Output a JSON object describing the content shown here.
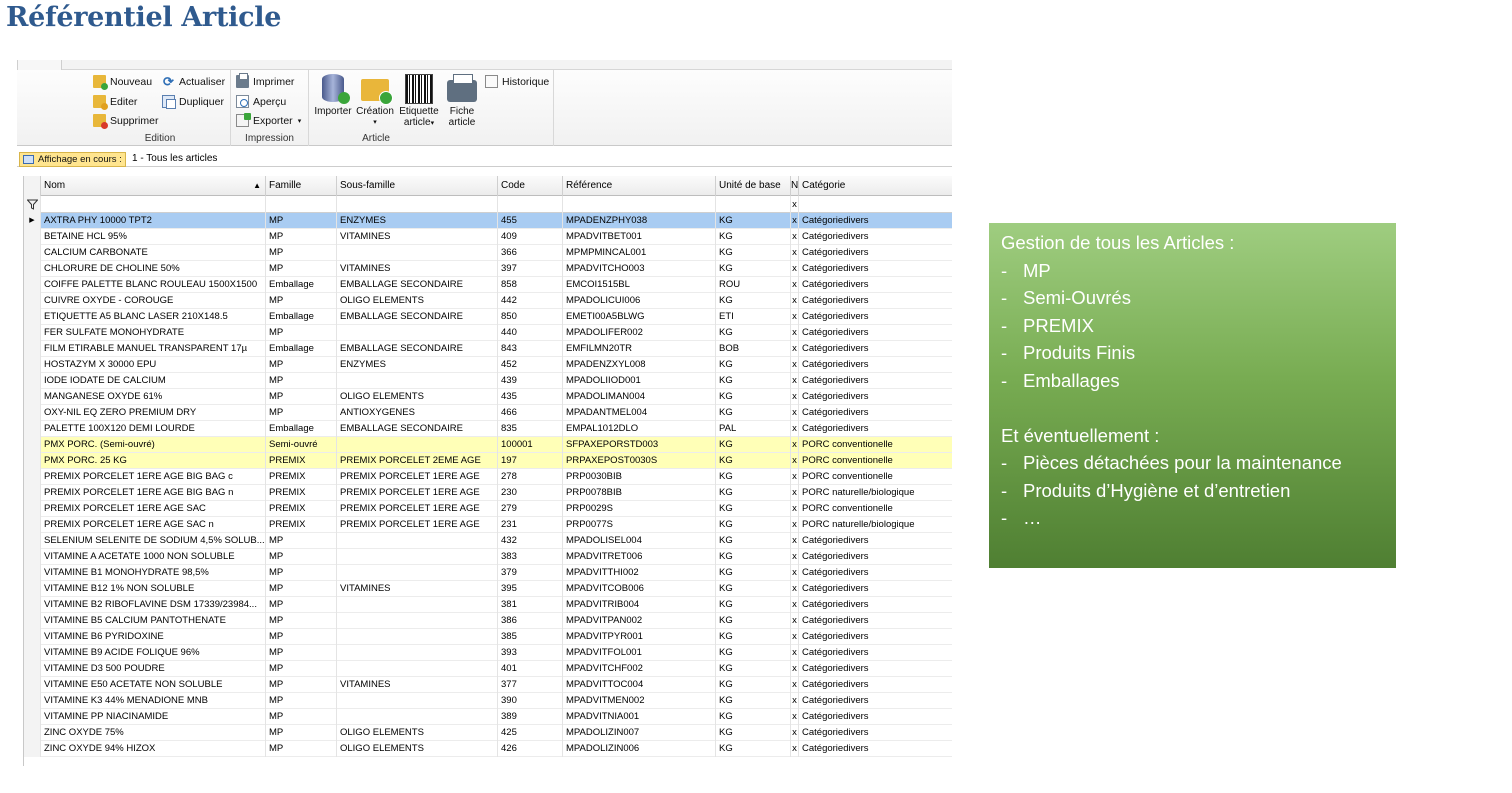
{
  "title": "Référentiel Article",
  "ribbon": {
    "edition": {
      "label": "Edition",
      "nouveau": "Nouveau",
      "actualiser": "Actualiser",
      "editer": "Editer",
      "dupliquer": "Dupliquer",
      "supprimer": "Supprimer"
    },
    "impression": {
      "label": "Impression",
      "imprimer": "Imprimer",
      "apercu": "Aperçu",
      "exporter": "Exporter"
    },
    "article": {
      "label": "Article",
      "importer": "Importer",
      "creation": "Création",
      "etiquette_1": "Etiquette",
      "etiquette_2": "article",
      "fiche_1": "Fiche",
      "fiche_2": "article",
      "historique": "Historique"
    }
  },
  "view": {
    "label": "Affichage en cours :",
    "value": "1 - Tous les articles"
  },
  "columns": {
    "nom": "Nom",
    "famille": "Famille",
    "sous_famille": "Sous-famille",
    "code": "Code",
    "reference": "Référence",
    "unite": "Unité de base",
    "n": "N",
    "categorie": "Catégorie"
  },
  "filter_row": {
    "n": "x"
  },
  "rows": [
    {
      "nom": "AXTRA PHY 10000 TPT2",
      "famille": "MP",
      "sous": "ENZYMES",
      "code": "455",
      "ref": "MPADENZPHY038",
      "unite": "KG",
      "n": "x",
      "cat": "Catégoriedivers",
      "state": "selected"
    },
    {
      "nom": "BETAINE HCL 95%",
      "famille": "MP",
      "sous": "VITAMINES",
      "code": "409",
      "ref": "MPADVITBET001",
      "unite": "KG",
      "n": "x",
      "cat": "Catégoriedivers"
    },
    {
      "nom": "CALCIUM CARBONATE",
      "famille": "MP",
      "sous": "",
      "code": "366",
      "ref": "MPMPMINCAL001",
      "unite": "KG",
      "n": "x",
      "cat": "Catégoriedivers"
    },
    {
      "nom": "CHLORURE DE CHOLINE 50%",
      "famille": "MP",
      "sous": "VITAMINES",
      "code": "397",
      "ref": "MPADVITCHO003",
      "unite": "KG",
      "n": "x",
      "cat": "Catégoriedivers"
    },
    {
      "nom": "COIFFE PALETTE BLANC ROULEAU 1500X1500",
      "famille": "Emballage",
      "sous": "EMBALLAGE SECONDAIRE",
      "code": "858",
      "ref": "EMCOI1515BL",
      "unite": "ROU",
      "n": "x",
      "cat": "Catégoriedivers"
    },
    {
      "nom": "CUIVRE OXYDE - COROUGE",
      "famille": "MP",
      "sous": "OLIGO ELEMENTS",
      "code": "442",
      "ref": "MPADOLICUI006",
      "unite": "KG",
      "n": "x",
      "cat": "Catégoriedivers"
    },
    {
      "nom": "ETIQUETTE A5 BLANC LASER 210X148.5",
      "famille": "Emballage",
      "sous": "EMBALLAGE SECONDAIRE",
      "code": "850",
      "ref": "EMETI00A5BLWG",
      "unite": "ETI",
      "n": "x",
      "cat": "Catégoriedivers"
    },
    {
      "nom": "FER SULFATE MONOHYDRATE",
      "famille": "MP",
      "sous": "",
      "code": "440",
      "ref": "MPADOLIFER002",
      "unite": "KG",
      "n": "x",
      "cat": "Catégoriedivers"
    },
    {
      "nom": "FILM ETIRABLE MANUEL TRANSPARENT 17µ",
      "famille": "Emballage",
      "sous": "EMBALLAGE SECONDAIRE",
      "code": "843",
      "ref": "EMFILMN20TR",
      "unite": "BOB",
      "n": "x",
      "cat": "Catégoriedivers"
    },
    {
      "nom": "HOSTAZYM X 30000 EPU",
      "famille": "MP",
      "sous": "ENZYMES",
      "code": "452",
      "ref": "MPADENZXYL008",
      "unite": "KG",
      "n": "x",
      "cat": "Catégoriedivers"
    },
    {
      "nom": "IODE IODATE DE CALCIUM",
      "famille": "MP",
      "sous": "",
      "code": "439",
      "ref": "MPADOLIIOD001",
      "unite": "KG",
      "n": "x",
      "cat": "Catégoriedivers"
    },
    {
      "nom": "MANGANESE OXYDE 61%",
      "famille": "MP",
      "sous": "OLIGO ELEMENTS",
      "code": "435",
      "ref": "MPADOLIMAN004",
      "unite": "KG",
      "n": "x",
      "cat": "Catégoriedivers"
    },
    {
      "nom": "OXY-NIL EQ ZERO PREMIUM DRY",
      "famille": "MP",
      "sous": "ANTIOXYGENES",
      "code": "466",
      "ref": "MPADANTMEL004",
      "unite": "KG",
      "n": "x",
      "cat": "Catégoriedivers"
    },
    {
      "nom": "PALETTE 100X120 DEMI LOURDE",
      "famille": "Emballage",
      "sous": "EMBALLAGE SECONDAIRE",
      "code": "835",
      "ref": "EMPAL1012DLO",
      "unite": "PAL",
      "n": "x",
      "cat": "Catégoriedivers"
    },
    {
      "nom": "PMX PORC. (Semi-ouvré)",
      "famille": "Semi-ouvré",
      "sous": "",
      "code": "100001",
      "ref": "SFPAXEPORSTD003",
      "unite": "KG",
      "n": "x",
      "cat": "PORC conventionelle",
      "state": "highlight"
    },
    {
      "nom": "PMX PORC. 25 KG",
      "famille": "PREMIX",
      "sous": "PREMIX PORCELET 2EME AGE",
      "code": "197",
      "ref": "PRPAXEPOST0030S",
      "unite": "KG",
      "n": "x",
      "cat": "PORC conventionelle",
      "state": "highlight"
    },
    {
      "nom": "PREMIX PORCELET 1ERE AGE  BIG BAG c",
      "famille": "PREMIX",
      "sous": "PREMIX PORCELET 1ERE AGE",
      "code": "278",
      "ref": "PRP0030BIB",
      "unite": "KG",
      "n": "x",
      "cat": "PORC conventionelle"
    },
    {
      "nom": "PREMIX PORCELET 1ERE AGE  BIG BAG n",
      "famille": "PREMIX",
      "sous": "PREMIX PORCELET 1ERE AGE",
      "code": "230",
      "ref": "PRP0078BIB",
      "unite": "KG",
      "n": "x",
      "cat": "PORC naturelle/biologique"
    },
    {
      "nom": "PREMIX PORCELET 1ERE AGE  SAC",
      "famille": "PREMIX",
      "sous": "PREMIX PORCELET 1ERE AGE",
      "code": "279",
      "ref": "PRP0029S",
      "unite": "KG",
      "n": "x",
      "cat": "PORC conventionelle"
    },
    {
      "nom": "PREMIX PORCELET 1ERE AGE  SAC n",
      "famille": "PREMIX",
      "sous": "PREMIX PORCELET 1ERE AGE",
      "code": "231",
      "ref": "PRP0077S",
      "unite": "KG",
      "n": "x",
      "cat": "PORC naturelle/biologique"
    },
    {
      "nom": "SELENIUM SELENITE DE SODIUM 4,5% SOLUB...",
      "famille": "MP",
      "sous": "",
      "code": "432",
      "ref": "MPADOLISEL004",
      "unite": "KG",
      "n": "x",
      "cat": "Catégoriedivers"
    },
    {
      "nom": "VITAMINE A ACETATE 1000 NON SOLUBLE",
      "famille": "MP",
      "sous": "",
      "code": "383",
      "ref": "MPADVITRET006",
      "unite": "KG",
      "n": "x",
      "cat": "Catégoriedivers"
    },
    {
      "nom": "VITAMINE B1 MONOHYDRATE 98,5%",
      "famille": "MP",
      "sous": "",
      "code": "379",
      "ref": "MPADVITTHI002",
      "unite": "KG",
      "n": "x",
      "cat": "Catégoriedivers"
    },
    {
      "nom": "VITAMINE B12 1% NON SOLUBLE",
      "famille": "MP",
      "sous": "VITAMINES",
      "code": "395",
      "ref": "MPADVITCOB006",
      "unite": "KG",
      "n": "x",
      "cat": "Catégoriedivers"
    },
    {
      "nom": "VITAMINE B2 RIBOFLAVINE DSM 17339/23984...",
      "famille": "MP",
      "sous": "",
      "code": "381",
      "ref": "MPADVITRIB004",
      "unite": "KG",
      "n": "x",
      "cat": "Catégoriedivers"
    },
    {
      "nom": "VITAMINE B5 CALCIUM PANTOTHENATE",
      "famille": "MP",
      "sous": "",
      "code": "386",
      "ref": "MPADVITPAN002",
      "unite": "KG",
      "n": "x",
      "cat": "Catégoriedivers"
    },
    {
      "nom": "VITAMINE B6 PYRIDOXINE",
      "famille": "MP",
      "sous": "",
      "code": "385",
      "ref": "MPADVITPYR001",
      "unite": "KG",
      "n": "x",
      "cat": "Catégoriedivers"
    },
    {
      "nom": "VITAMINE B9 ACIDE FOLIQUE 96%",
      "famille": "MP",
      "sous": "",
      "code": "393",
      "ref": "MPADVITFOL001",
      "unite": "KG",
      "n": "x",
      "cat": "Catégoriedivers"
    },
    {
      "nom": "VITAMINE D3 500 POUDRE",
      "famille": "MP",
      "sous": "",
      "code": "401",
      "ref": "MPADVITCHF002",
      "unite": "KG",
      "n": "x",
      "cat": "Catégoriedivers"
    },
    {
      "nom": "VITAMINE E50 ACETATE NON SOLUBLE",
      "famille": "MP",
      "sous": "VITAMINES",
      "code": "377",
      "ref": "MPADVITTOC004",
      "unite": "KG",
      "n": "x",
      "cat": "Catégoriedivers"
    },
    {
      "nom": "VITAMINE K3 44% MENADIONE MNB",
      "famille": "MP",
      "sous": "",
      "code": "390",
      "ref": "MPADVITMEN002",
      "unite": "KG",
      "n": "x",
      "cat": "Catégoriedivers"
    },
    {
      "nom": "VITAMINE PP NIACINAMIDE",
      "famille": "MP",
      "sous": "",
      "code": "389",
      "ref": "MPADVITNIA001",
      "unite": "KG",
      "n": "x",
      "cat": "Catégoriedivers"
    },
    {
      "nom": "ZINC OXYDE 75%",
      "famille": "MP",
      "sous": "OLIGO ELEMENTS",
      "code": "425",
      "ref": "MPADOLIZIN007",
      "unite": "KG",
      "n": "x",
      "cat": "Catégoriedivers"
    },
    {
      "nom": "ZINC OXYDE 94% HIZOX",
      "famille": "MP",
      "sous": "OLIGO ELEMENTS",
      "code": "426",
      "ref": "MPADOLIZIN006",
      "unite": "KG",
      "n": "x",
      "cat": "Catégoriedivers"
    }
  ],
  "info": {
    "heading": "Gestion de tous les Articles :",
    "items": [
      "MP",
      "Semi-Ouvrés",
      "PREMIX",
      "Produits Finis",
      "Emballages"
    ],
    "heading2": "Et éventuellement :",
    "items2": [
      "Pièces détachées pour la maintenance",
      "Produits d’Hygiène et d’entretien",
      "…"
    ],
    "dash": "-"
  },
  "colors": {
    "title": "#2f5a8e",
    "selected_row": "#a9ccf2",
    "highlight_row": "#ffffb7",
    "info_top": "#9fcd80",
    "info_bottom": "#4f7f32"
  }
}
